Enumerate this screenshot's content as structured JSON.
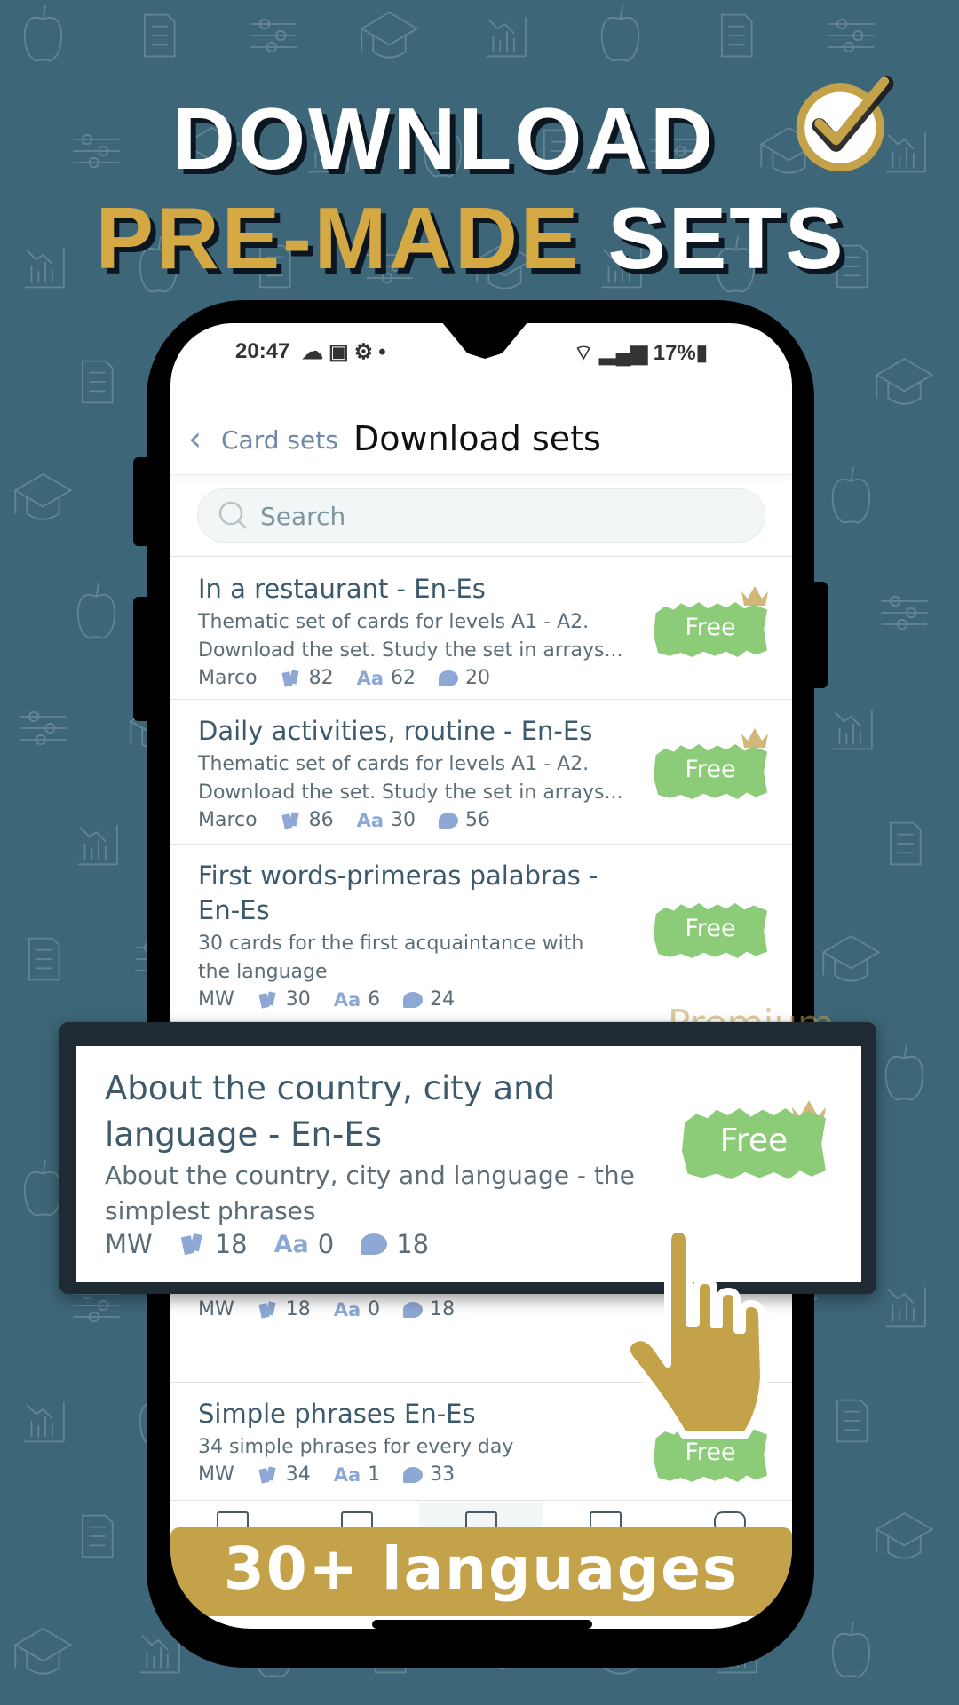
{
  "promo": {
    "headline_line1": "DOWNLOAD",
    "headline_line2_accent": "PRE-MADE",
    "headline_line2_rest": " SETS",
    "banner": "30+ languages",
    "ghost_label": "Premium"
  },
  "colors": {
    "background": "#3d6679",
    "gold": "#c4a24a",
    "free_badge": "#8ccc78",
    "title_text": "#3d5a6c",
    "meta_icon": "#8ea8d6"
  },
  "status_bar": {
    "time": "20:47",
    "battery": "17%",
    "left_icons": [
      "cloud-icon",
      "calendar-icon",
      "settings-icon",
      "dot-icon"
    ],
    "right_icons": [
      "wifi-icon",
      "signal-icon",
      "battery-icon"
    ]
  },
  "header": {
    "back_label": "Card sets",
    "title": "Download sets"
  },
  "search": {
    "placeholder": "Search",
    "value": ""
  },
  "sets": [
    {
      "title": "In a restaurant - En-Es",
      "description": "Thematic set of cards for levels A1 - A2. Download the set. Study the set in arrays...",
      "author": "Marco",
      "cards": "82",
      "words": "62",
      "comments": "20",
      "badge": "Free",
      "premium_crown": true
    },
    {
      "title": "Daily activities, routine - En-Es",
      "description": "Thematic set of cards for levels A1 - A2. Download the set. Study the set in arrays...",
      "author": "Marco",
      "cards": "86",
      "words": "30",
      "comments": "56",
      "badge": "Free",
      "premium_crown": true
    },
    {
      "title": "First words-primeras palabras -En-Es",
      "description": "30 cards for the first acquaintance with the language",
      "author": "MW",
      "cards": "30",
      "words": "6",
      "comments": "24",
      "badge": "Free",
      "premium_crown": false
    },
    {
      "title": "About the country, city and language - En-Es",
      "description": "About the country, city and language - the simplest phrases",
      "author": "MW",
      "cards": "18",
      "words": "0",
      "comments": "18",
      "badge": "Free",
      "premium_crown": true
    },
    {
      "title": "Simple phrases En-Es",
      "description": "34 simple phrases for every day",
      "author": "MW",
      "cards": "34",
      "words": "1",
      "comments": "33",
      "badge": "Free",
      "premium_crown": false
    }
  ],
  "meta_labels": {
    "words_icon_text": "Aa"
  },
  "bottom_nav": [
    {
      "icon": "cards-icon",
      "active": false
    },
    {
      "icon": "home-icon",
      "active": false
    },
    {
      "icon": "download-sets-icon",
      "active": true
    },
    {
      "icon": "statistics-icon",
      "active": false
    },
    {
      "icon": "settings-toggle-icon",
      "active": false
    }
  ]
}
